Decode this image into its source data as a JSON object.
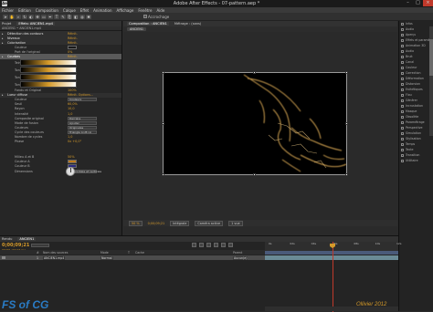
{
  "window": {
    "title": "Adobe After Effects - 07-pattern.aep *",
    "icon": "Ae"
  },
  "menu": [
    "Fichier",
    "Edition",
    "Composition",
    "Calque",
    "Effet",
    "Animation",
    "Affichage",
    "Fenêtre",
    "Aide"
  ],
  "toolbar": {
    "snap_label": "Accrochage"
  },
  "effects_panel": {
    "tabs": [
      "Projet",
      "Effets: ANCIEN1.mp4"
    ],
    "subtitle": "ANCIEN1 • ANCIEN1.mp4",
    "rows": [
      {
        "label": "Détection des contours",
        "value": "Réinit.",
        "kind": "header"
      },
      {
        "label": "Niveaux",
        "value": "Réinit.",
        "kind": "header"
      },
      {
        "label": "Colorisation",
        "value": "Réinit.",
        "kind": "header"
      },
      {
        "label": "Couleur",
        "value": "",
        "kind": "swatch"
      },
      {
        "label": "Part de l'original",
        "value": "0%",
        "kind": "prop"
      },
      {
        "label": "Courbes",
        "value": "Réinit.",
        "kind": "selected"
      },
      {
        "label": "Teintes",
        "value": "",
        "kind": "graph"
      },
      {
        "label": "Tons foncés",
        "value": "",
        "kind": "graph"
      },
      {
        "label": "Tons moyens",
        "value": "",
        "kind": "graph"
      },
      {
        "label": "Tons clairs",
        "value": "",
        "kind": "graph"
      },
      {
        "label": "Fondu et Original",
        "value": "100%",
        "kind": "prop"
      },
      {
        "label": "Lueur diffuse",
        "value": "Réinit.  Options...",
        "kind": "header"
      },
      {
        "label": "Couleur",
        "value": "Couleurs",
        "kind": "dropdown"
      },
      {
        "label": "Seuil",
        "value": "60,0%",
        "kind": "prop"
      },
      {
        "label": "Rayon",
        "value": "10,0",
        "kind": "prop"
      },
      {
        "label": "Intensité",
        "value": "1,0",
        "kind": "prop"
      },
      {
        "label": "Composite original",
        "value": "Derrière",
        "kind": "dropdown"
      },
      {
        "label": "Mode de fusion",
        "value": "Ajouter",
        "kind": "dropdown"
      },
      {
        "label": "Couleurs",
        "value": "Originales",
        "kind": "dropdown"
      },
      {
        "label": "Cycle des couleurs",
        "value": "Triangle A>B>A",
        "kind": "dropdown"
      },
      {
        "label": "Nombre de cycles",
        "value": "1,0",
        "kind": "prop"
      },
      {
        "label": "Phase",
        "value": "0x +0,0°",
        "kind": "prop"
      },
      {
        "label": "",
        "value": "",
        "kind": "dial"
      },
      {
        "label": "Milieu A et B",
        "value": "50%",
        "kind": "prop"
      },
      {
        "label": "Couleur A",
        "value": "",
        "kind": "swatch"
      },
      {
        "label": "Couleur B",
        "value": "",
        "kind": "swatch"
      },
      {
        "label": "Dimensions",
        "value": "Horizontale et verticale",
        "kind": "dropdown"
      }
    ]
  },
  "composition_panel": {
    "tabs": [
      "Composition : ANCIEN1",
      "Métrage : (sans)"
    ],
    "breadcrumb": "ANCIEN1",
    "controls": [
      "50 %",
      "0;00;09;21",
      "Intégrale",
      "Caméra active",
      "1 vue"
    ]
  },
  "right_panel": {
    "rows": [
      "Infos",
      "Audio",
      "Aperçu",
      "Effets et paramètres",
      "Animation 3D",
      "Audio",
      "Bruit",
      "Canal",
      "Couleur",
      "Correction",
      "Déformation",
      "Distorsion",
      "Esthétiques",
      "Flou",
      "Générer",
      "Incrustation",
      "Masque",
      "Obsolète",
      "Paramétrage",
      "Perspective",
      "Simulation",
      "Stylisation",
      "Temps",
      "Texte",
      "Transition",
      "Utilitaire"
    ]
  },
  "timeline": {
    "tabs": [
      "Rendu",
      "ANCIEN1"
    ],
    "timecode": "0;00;09;21",
    "fps": "00291 (29,97 i/s)",
    "columns": [
      "#",
      "Nom des sources",
      "Mode",
      "T",
      "Cache",
      "Parent"
    ],
    "layer": {
      "index": "1",
      "name": "ANCIEN1.mp4",
      "mode": "Normal",
      "parent": "Aucun(e)"
    },
    "ruler_ticks": [
      "0s",
      "02s",
      "04s",
      "06s",
      "08s",
      "10s",
      "12s"
    ]
  },
  "watermark": {
    "left": "FS of CG",
    "right": "Ollivier 2012"
  },
  "colors": {
    "accent": "#d59a2a",
    "panel": "#262626",
    "selected": "#5a5a5a",
    "layer_bar": "#6a8a96",
    "cti": "#c0392b"
  }
}
